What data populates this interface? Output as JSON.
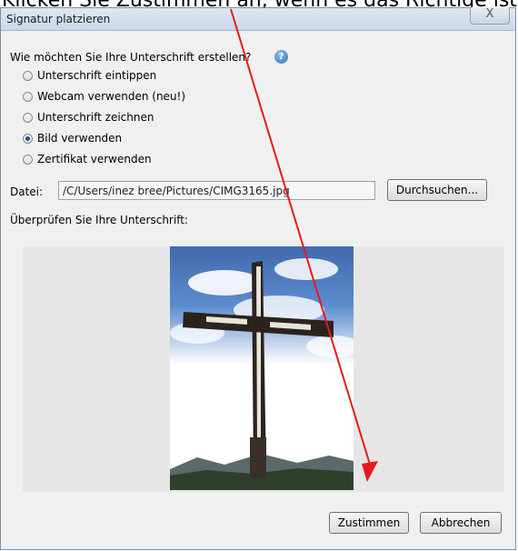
{
  "caption": "Klicken Sie Zustimmen an, wenn es das Richtige ist",
  "window": {
    "title": "Signatur platzieren",
    "close_glyph": "X"
  },
  "dialog": {
    "question": "Wie möchten Sie Ihre Unterschrift erstellen?",
    "help_glyph": "?",
    "options": [
      {
        "label": "Unterschrift eintippen",
        "checked": false
      },
      {
        "label": "Webcam verwenden (neu!)",
        "checked": false
      },
      {
        "label": "Unterschrift zeichnen",
        "checked": false
      },
      {
        "label": "Bild verwenden",
        "checked": true
      },
      {
        "label": "Zertifikat verwenden",
        "checked": false
      }
    ],
    "file_label": "Datei:",
    "file_path": "/C/Users/inez bree/Pictures/CIMG3165.jpg",
    "browse_label": "Durchsuchen...",
    "review_label": "Überprüfen Sie Ihre Unterschrift:",
    "accept_label": "Zustimmen",
    "cancel_label": "Abbrechen"
  },
  "colors": {
    "arrow": "#e8191a",
    "titlebar": "#c9d8ea"
  }
}
